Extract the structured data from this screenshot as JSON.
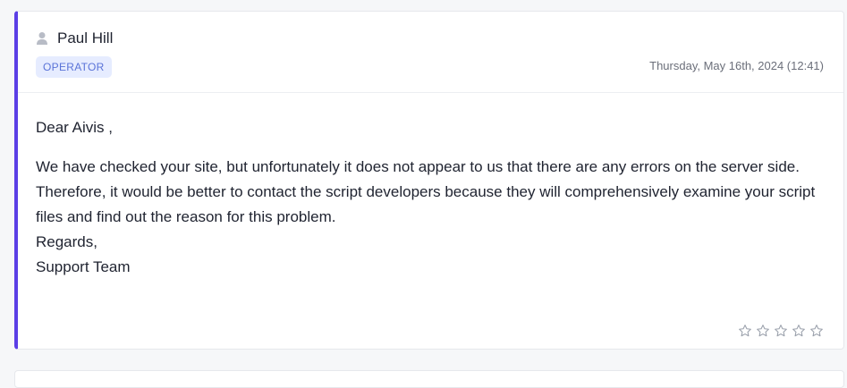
{
  "message": {
    "author": "Paul Hill",
    "role": "OPERATOR",
    "timestamp": "Thursday, May 16th, 2024 (12:41)",
    "greeting": "Dear Aivis ,",
    "lines": [
      "We have checked your site, but unfortunately it does not appear to us that there are any errors on the server side.",
      "Therefore, it would be better to contact the script developers because they will comprehensively examine your script files and find out the reason for this problem.",
      "Regards,",
      "Support Team"
    ],
    "rating": 0,
    "rating_max": 5
  },
  "colors": {
    "accent": "#5b3ee6",
    "badge_bg": "#e6ecff",
    "badge_text": "#5a73d8",
    "star": "#9aa0ab"
  },
  "icons": {
    "user": "user-icon",
    "star": "star-outline-icon"
  }
}
